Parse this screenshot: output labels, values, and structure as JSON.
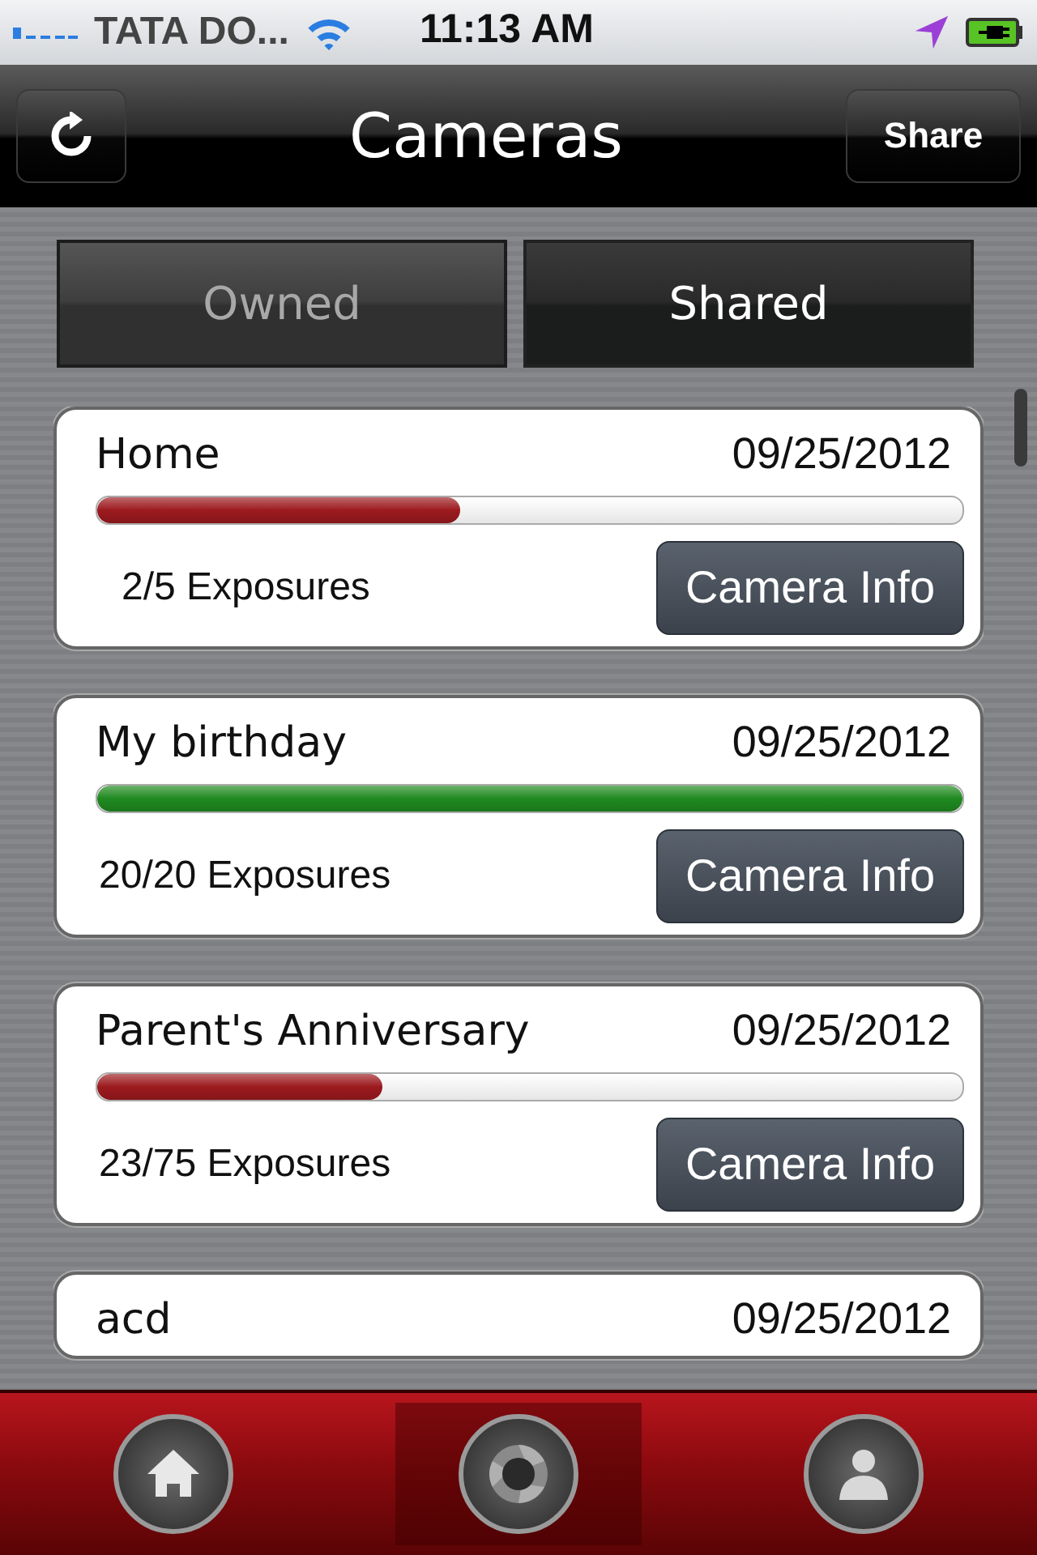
{
  "status_bar": {
    "carrier": "TATA DO...",
    "time": "11:13 AM"
  },
  "header": {
    "title": "Cameras",
    "action": "Share"
  },
  "tabs": [
    {
      "label": "Owned",
      "selected": false
    },
    {
      "label": "Shared",
      "selected": true
    }
  ],
  "cameras": [
    {
      "name": "Home",
      "date": "09/25/2012",
      "level": 0.42,
      "color": "#9c1a1e",
      "exposures": "2/5 Exposures",
      "button": "Camera Info"
    },
    {
      "name": "My birthday",
      "date": "09/25/2012",
      "level": 1,
      "color": "#1f8a1f",
      "exposures": "20/20 Exposures",
      "button": "Camera Info"
    },
    {
      "name": "Parent's Anniversary",
      "date": "09/25/2012",
      "level": 0.33,
      "color": "#9c1a1e",
      "exposures": "23/75 Exposures",
      "button": "Camera Info"
    },
    {
      "name": "acd",
      "date": "09/25/2012"
    }
  ],
  "tab_bar": [
    {
      "kind": "home",
      "selected": false
    },
    {
      "kind": "camera",
      "selected": true
    },
    {
      "kind": "profile",
      "selected": false
    }
  ]
}
